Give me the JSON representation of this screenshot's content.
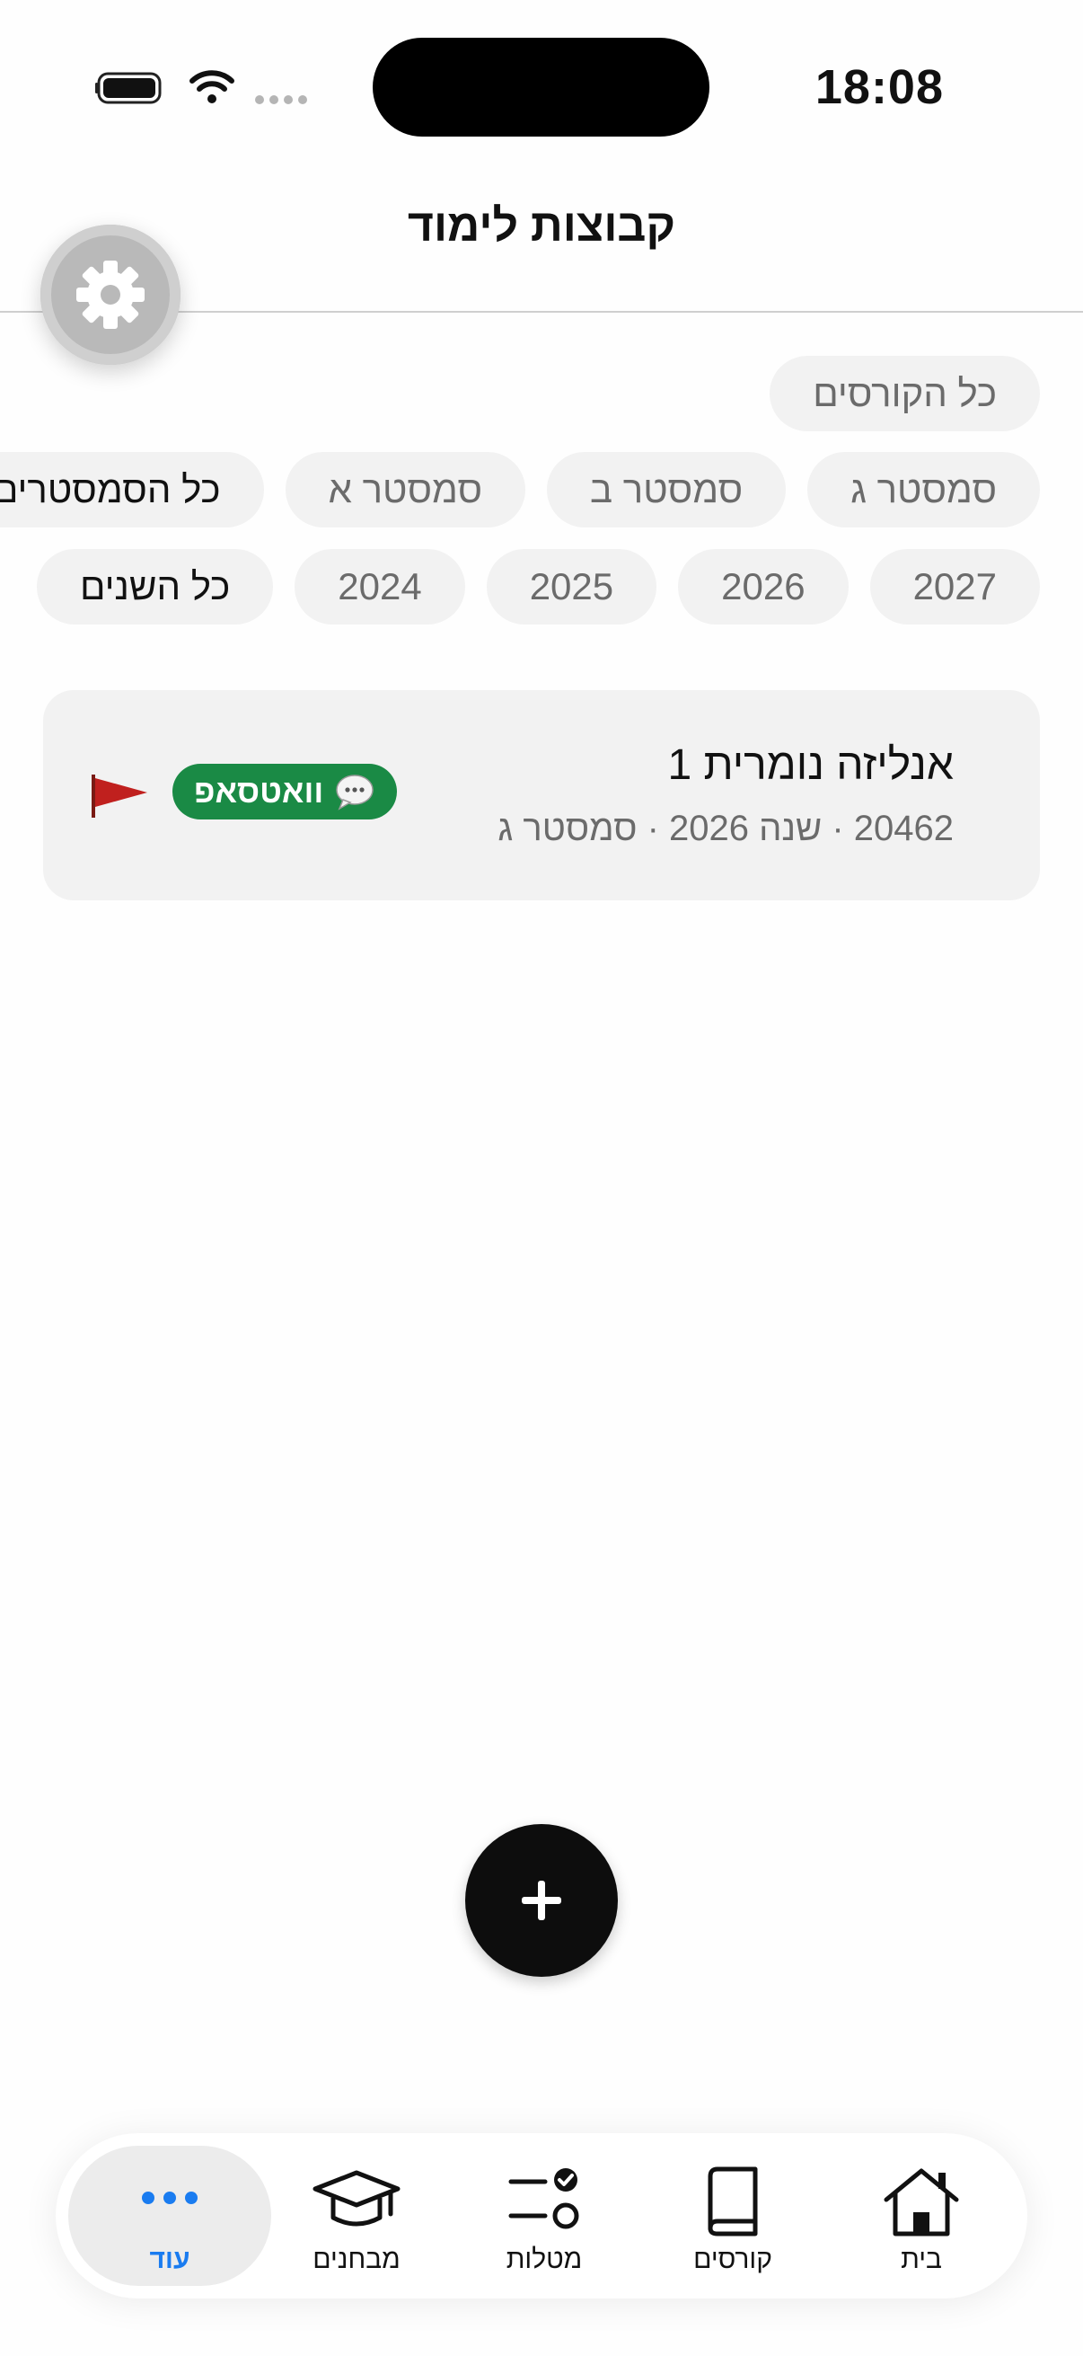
{
  "status_bar": {
    "time": "18:08"
  },
  "header": {
    "title": "קבוצות לימוד"
  },
  "filters": {
    "courses": [
      "כל הקורסים"
    ],
    "semesters": [
      "כל הסמסטרים",
      "סמסטר א",
      "סמסטר ב",
      "סמסטר ג"
    ],
    "years": [
      "כל השנים",
      "2024",
      "2025",
      "2026",
      "2027"
    ]
  },
  "group_card": {
    "title": "אנליזה נומרית 1",
    "subtitle": "20462 · שנה 2026 · סמסטר ג",
    "whatsapp_label": "וואטסאפ"
  },
  "tabs": {
    "home": "בית",
    "courses": "קורסים",
    "tasks": "מטלות",
    "exams": "מבחנים",
    "more": "עוד"
  },
  "colors": {
    "accent": "#1a7cf0",
    "whatsapp": "#1a8a45",
    "flag": "#c0201e"
  },
  "icons": [
    "settings-gear-icon",
    "flag-icon",
    "chat-bubble-icon",
    "plus-icon",
    "home-icon",
    "book-icon",
    "tasks-icon",
    "graduation-cap-icon",
    "more-dots-icon"
  ]
}
